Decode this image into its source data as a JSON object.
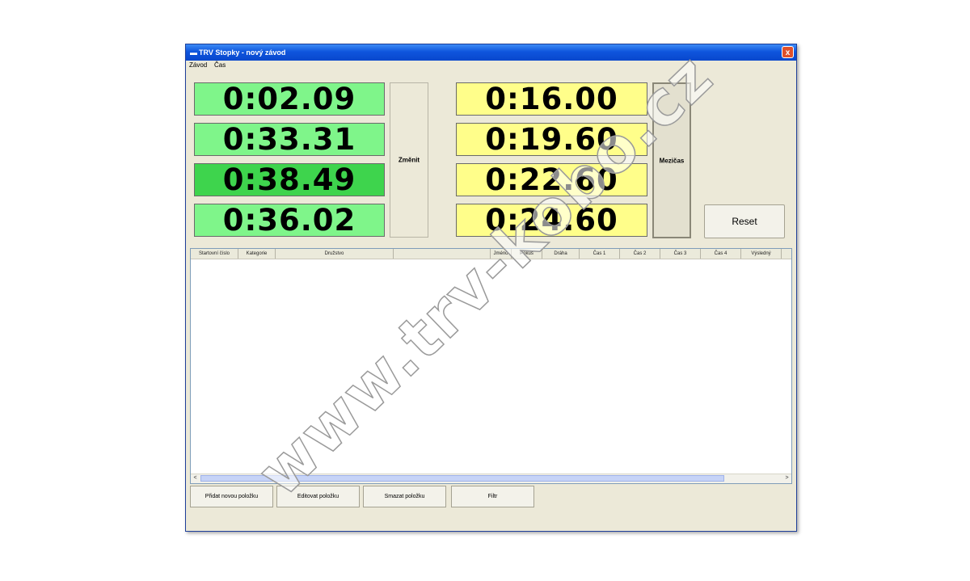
{
  "window": {
    "title": "TRV Stopky - nový závod",
    "close_label": "x"
  },
  "menu": [
    "Závod",
    "Čas"
  ],
  "timers_left": [
    "0:02.09",
    "0:33.31",
    "0:38.49",
    "0:36.02"
  ],
  "timers_right": [
    "0:16.00",
    "0:19.60",
    "0:22.60",
    "0:24.60"
  ],
  "buttons": {
    "zmenit": "Změnit",
    "mezicas": "Mezičas",
    "reset": "Reset",
    "add": "Přidat novou položku",
    "edit": "Editovat položku",
    "delete": "Smazat položku",
    "filter": "Filtr"
  },
  "table": {
    "columns": [
      "Startovní číslo",
      "Kategorie",
      "Družstvo",
      "",
      "Jméno",
      "Pokus",
      "Dráha",
      "Čas 1",
      "Čas 2",
      "Čas 3",
      "Čas 4",
      "Výsledný",
      ""
    ]
  },
  "scrollbar": {
    "left_arrow": "<",
    "right_arrow": ">"
  },
  "watermark": "www.trv-kobo.cz",
  "colors": {
    "green": "#7ff58a",
    "green_active": "#3ed44d",
    "yellow": "#fffe8a",
    "titlebar": "#0f55dd"
  }
}
